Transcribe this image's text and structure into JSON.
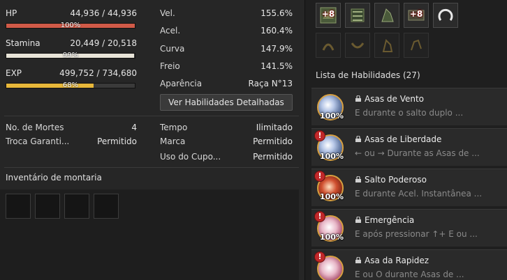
{
  "stats": {
    "hp": {
      "label": "HP",
      "value": "44,936 / 44,936",
      "percent": "100%",
      "fraction": 1.0
    },
    "stamina": {
      "label": "Stamina",
      "value": "20,449 / 20,518",
      "percent": "99%",
      "fraction": 0.9966
    },
    "exp": {
      "label": "EXP",
      "value": "499,752 / 734,680",
      "percent": "68%",
      "fraction": 0.68
    }
  },
  "attributes": [
    {
      "label": "Vel.",
      "value": "155.6%"
    },
    {
      "label": "Acel.",
      "value": "160.4%"
    },
    {
      "label": "Curva",
      "value": "147.9%"
    },
    {
      "label": "Freio",
      "value": "141.5%"
    },
    {
      "label": "Aparência",
      "value": "Raça N°13"
    }
  ],
  "detail_button": "Ver Habilidades Detalhadas",
  "info_left": [
    {
      "label": "No. de Mortes",
      "value": "4"
    },
    {
      "label": "Troca Garanti...",
      "value": "Permitido"
    }
  ],
  "info_right": [
    {
      "label": "Tempo",
      "value": "Ilimitado"
    },
    {
      "label": "Marca",
      "value": "Permitido"
    },
    {
      "label": "Uso do Cupo...",
      "value": "Permitido"
    }
  ],
  "inventory": {
    "title": "Inventário de montaria"
  },
  "equipment": {
    "row1": [
      {
        "icon": "saddle-gear-icon",
        "enhance": "+8"
      },
      {
        "icon": "stirrups-gear-icon",
        "enhance": ""
      },
      {
        "icon": "barding-gear-icon",
        "enhance": ""
      },
      {
        "icon": "horseshoe-gear-icon",
        "enhance": "+8"
      },
      {
        "icon": "horseshoe-ring-icon",
        "enhance": ""
      }
    ],
    "row2": [
      {
        "icon": "empty-saddle-slot-icon"
      },
      {
        "icon": "empty-stirrup-slot-icon"
      },
      {
        "icon": "empty-barding-slot-icon"
      },
      {
        "icon": "empty-horseshoe-slot-icon"
      }
    ]
  },
  "skills": {
    "title": "Lista de Habilidades (27)",
    "items": [
      {
        "name": "Asas de Vento",
        "desc": "E durante o salto duplo ...",
        "percent": "100%",
        "alert": false,
        "icon": "wind-wings-icon",
        "tint": "blue"
      },
      {
        "name": "Asas de Liberdade",
        "desc": "← ou → Durante as Asas de ...",
        "percent": "100%",
        "alert": true,
        "icon": "freedom-wings-icon",
        "tint": "blue"
      },
      {
        "name": "Salto Poderoso",
        "desc": "E durante Acel. Instantânea ...",
        "percent": "100%",
        "alert": true,
        "icon": "power-jump-icon",
        "tint": "red"
      },
      {
        "name": "Emergência",
        "desc": "E após pressionar ↑+ E ou ...",
        "percent": "100%",
        "alert": true,
        "icon": "emergency-pegasus-icon",
        "tint": "pink"
      },
      {
        "name": "Asa da Rapidez",
        "desc": "E ou O durante Asas de ...",
        "percent": "100%",
        "alert": true,
        "icon": "swift-wing-pegasus-icon",
        "tint": "pink"
      }
    ]
  }
}
